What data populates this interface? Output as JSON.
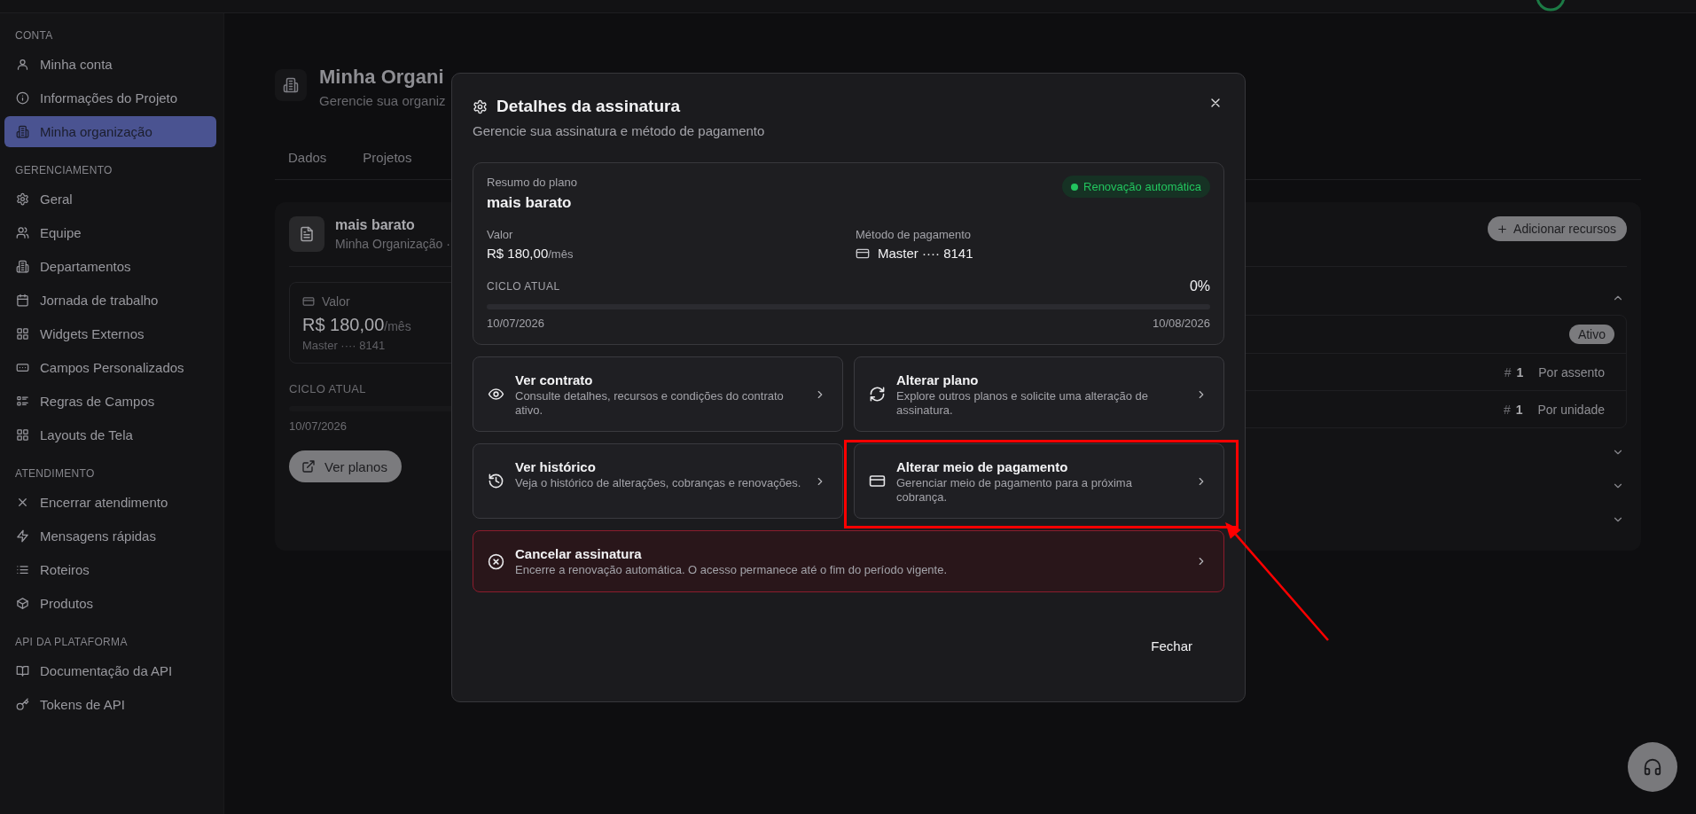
{
  "sidebar": {
    "sections": [
      {
        "title": "CONTA",
        "items": [
          {
            "label": "Minha conta",
            "selected": false
          },
          {
            "label": "Informações do Projeto",
            "selected": false
          },
          {
            "label": "Minha organização",
            "selected": true
          }
        ]
      },
      {
        "title": "GERENCIAMENTO",
        "items": [
          {
            "label": "Geral",
            "selected": false
          },
          {
            "label": "Equipe",
            "selected": false
          },
          {
            "label": "Departamentos",
            "selected": false
          },
          {
            "label": "Jornada de trabalho",
            "selected": false
          },
          {
            "label": "Widgets Externos",
            "selected": false
          },
          {
            "label": "Campos Personalizados",
            "selected": false
          },
          {
            "label": "Regras de Campos",
            "selected": false
          },
          {
            "label": "Layouts de Tela",
            "selected": false
          }
        ]
      },
      {
        "title": "ATENDIMENTO",
        "items": [
          {
            "label": "Encerrar atendimento",
            "selected": false
          },
          {
            "label": "Mensagens rápidas",
            "selected": false
          },
          {
            "label": "Roteiros",
            "selected": false
          },
          {
            "label": "Produtos",
            "selected": false
          }
        ]
      },
      {
        "title": "API DA PLATAFORMA",
        "items": [
          {
            "label": "Documentação da API",
            "selected": false
          },
          {
            "label": "Tokens de API",
            "selected": false
          }
        ]
      }
    ]
  },
  "page": {
    "title": "Minha Organi",
    "subtitle": "Gerencie sua organiz",
    "tabs": [
      {
        "label": "Dados",
        "selected": false
      },
      {
        "label": "Projetos",
        "selected": false
      }
    ],
    "plan": {
      "name": "mais barato",
      "owner": "Minha Organização ·",
      "value_label": "Valor",
      "price": "R$ 180,00",
      "period": "/mês",
      "payment": "Master ···· 8141",
      "cycle": {
        "label": "CICLO ATUAL",
        "level": 0,
        "start": "10/07/2026"
      },
      "button": "Ver planos"
    },
    "resources": {
      "add_button": "Adicionar recursos",
      "sections": [
        {
          "expanded": true,
          "rows": [
            {
              "kind": "status",
              "status": "Ativo"
            },
            {
              "kind": "quantity",
              "symbol": "#",
              "quantity": "1",
              "billing": "Por assento"
            },
            {
              "kind": "quantity",
              "symbol": "#",
              "quantity": "1",
              "billing": "Por unidade"
            }
          ]
        },
        {
          "expanded": false
        },
        {
          "expanded": false
        },
        {
          "expanded": false
        }
      ]
    }
  },
  "modal": {
    "title": "Detalhes da assinatura",
    "subtitle": "Gerencie sua assinatura e método de pagamento",
    "summary": {
      "label": "Resumo do plano",
      "plan": "mais barato",
      "badge": "Renovação automática",
      "value_label": "Valor",
      "price": "R$ 180,00",
      "period": "/mês",
      "method_label": "Método de pagamento",
      "method": "Master ···· 8141",
      "cycle": {
        "label": "CICLO ATUAL",
        "percent": "0%",
        "level": 0,
        "start": "10/07/2026",
        "end": "10/08/2026"
      }
    },
    "actions": [
      {
        "kind": "option",
        "title": "Ver contrato",
        "description": "Consulte detalhes, recursos e condições do contrato ativo.",
        "highlighted": false
      },
      {
        "kind": "option",
        "title": "Alterar plano",
        "description": "Explore outros planos e solicite uma alteração de assinatura.",
        "highlighted": false
      },
      {
        "kind": "option",
        "title": "Ver histórico",
        "description": "Veja o histórico de alterações, cobranças e renovações.",
        "highlighted": false
      },
      {
        "kind": "option",
        "title": "Alterar meio de pagamento",
        "description": "Gerenciar meio de pagamento para a próxima cobrança.",
        "highlighted": true
      },
      {
        "kind": "danger",
        "title": "Cancelar assinatura",
        "description": "Encerre a renovação automática. O acesso permanece até o fim do período vigente.",
        "highlighted": false
      }
    ],
    "close_button": "Fechar"
  }
}
